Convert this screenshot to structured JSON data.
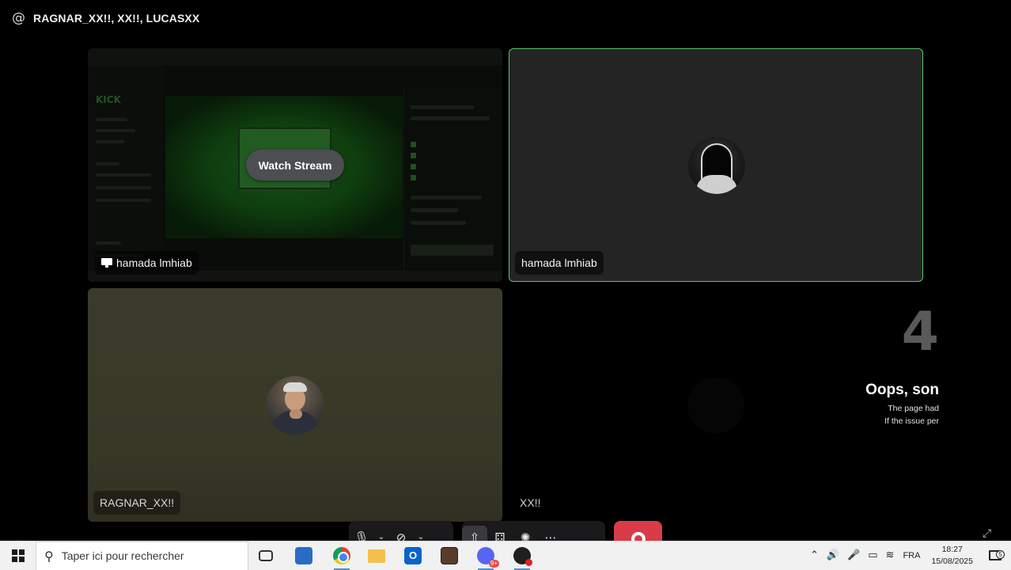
{
  "header": {
    "title": "RAGNAR_XX!!, XX!!, LUCASXX",
    "icon": "at-icon"
  },
  "tiles": {
    "stream": {
      "watch_label": "Watch Stream",
      "name": "hamada lmhiab",
      "logo_text": "KICK"
    },
    "hamada": {
      "name": "hamada lmhiab"
    },
    "ragnar": {
      "name": "RAGNAR_XX!!"
    },
    "xx": {
      "name": "XX!!",
      "error_code": "4",
      "error_title": "Oops, son",
      "error_line_1": "The page had",
      "error_line_2": "If the issue per"
    }
  },
  "controls": {
    "icons": [
      "microphone-icon",
      "chevron-down-icon",
      "camera-off-icon",
      "chevron-down-icon",
      "screen-share-icon",
      "activity-icon",
      "soundboard-icon",
      "more-icon",
      "end-call-icon"
    ]
  },
  "taskbar": {
    "search_placeholder": "Taper ici pour rechercher",
    "discord_badge": "9+",
    "outlook_letter": "O",
    "language": "FRA",
    "time": "18:27",
    "date": "15/08/2025",
    "notification_count": "5"
  },
  "colors": {
    "speaking_border": "#56c66a",
    "end_call": "#d83c48",
    "background": "#000000"
  }
}
